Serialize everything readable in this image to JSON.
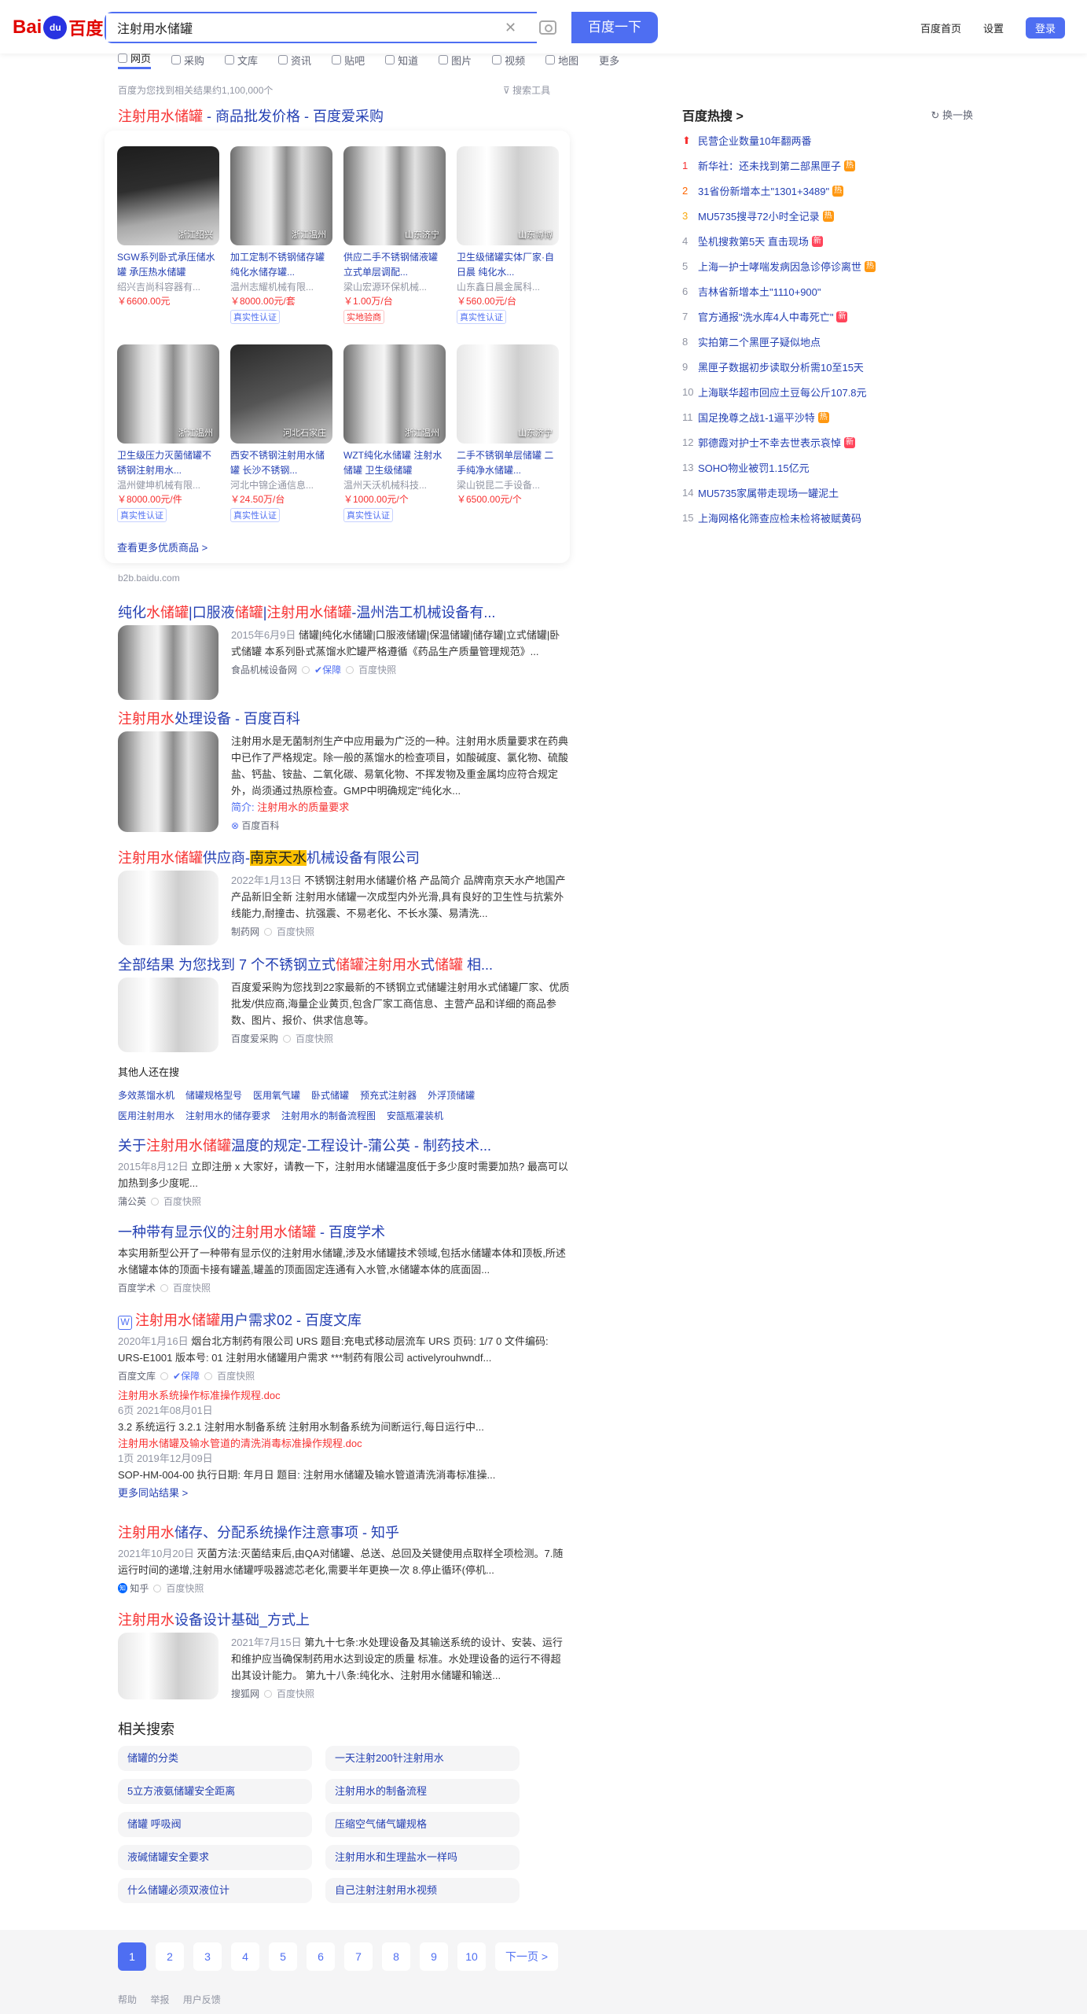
{
  "header": {
    "logo_bai": "Bai",
    "logo_paw": "du",
    "logo_du": "百度",
    "query": "注射用水储罐",
    "search_btn": "百度一下",
    "links": [
      "百度首页",
      "设置"
    ],
    "login": "登录"
  },
  "tabs": [
    "网页",
    "采购",
    "文库",
    "资讯",
    "贴吧",
    "知道",
    "图片",
    "视频",
    "地图",
    "更多"
  ],
  "result_info": "百度为您找到相关结果约1,100,000个",
  "tools": "搜索工具",
  "b2b": {
    "title_a": "注射用水储罐",
    "title_b": " - 商品批发价格 - 百度爱采购",
    "more": "查看更多优质商品 >",
    "domain": "b2b.baidu.com",
    "items": [
      {
        "loc": "浙江绍兴",
        "title": "SGW系列卧式承压储水罐 承压热水储罐",
        "company": "绍兴吉尚科容器有...",
        "price": "￥6600.00元",
        "badge": ""
      },
      {
        "loc": "浙江温州",
        "title": "加工定制不锈钢储存罐 纯化水储存罐...",
        "company": "温州志耀机械有限...",
        "price": "￥8000.00元/套",
        "badge": "真实性认证"
      },
      {
        "loc": "山东济宁",
        "title": "供应二手不锈钢储液罐 立式单层调配...",
        "company": "梁山宏源环保机械...",
        "price": "￥1.00万/台",
        "badge": "实地验商"
      },
      {
        "loc": "山东博博",
        "title": "卫生级储罐实体厂家·自日晨 纯化水...",
        "company": "山东鑫日晨金属科...",
        "price": "￥560.00元/台",
        "badge": "真实性认证"
      },
      {
        "loc": "浙江温州",
        "title": "卫生级压力灭菌储罐不锈钢注射用水...",
        "company": "温州健坤机械有限...",
        "price": "￥8000.00元/件",
        "badge": "真实性认证"
      },
      {
        "loc": "河北石家庄",
        "title": "西安不锈钢注射用水储罐 长沙不锈钢...",
        "company": "河北中锦企通信息...",
        "price": "￥24.50万/台",
        "badge": "真实性认证"
      },
      {
        "loc": "浙江温州",
        "title": "WZT纯化水储罐 注射水储罐 卫生级储罐",
        "company": "温州天沃机械科技...",
        "price": "￥1000.00元/个",
        "badge": "真实性认证"
      },
      {
        "loc": "山东济宁",
        "title": "二手不锈钢单层储罐 二手纯净水储罐...",
        "company": "梁山锐昆二手设备...",
        "price": "￥6500.00元/个",
        "badge": ""
      }
    ]
  },
  "results": [
    {
      "title": "纯化水储罐|口服液储罐|注射用水储罐-温州浩工机械设备有...",
      "date": "2015年6月9日",
      "text": "储罐|纯化水储罐|口服液储罐|保温储罐|储存罐|立式储罐|卧式储罐 本系列卧式蒸馏水贮罐严格遵循《药品生产质量管理规范》...",
      "source": "食品机械设备网",
      "snap": "百度快照"
    },
    {
      "title": "注射用水处理设备 - 百度百科",
      "text": "注射用水是无菌制剂生产中应用最为广泛的一种。注射用水质量要求在药典中已作了严格规定。除一般的蒸馏水的检查项目，如酸碱度、氯化物、硫酸盐、钙盐、铵盐、二氧化碳、易氧化物、不挥发物及重金属均应符合规定外，尚须通过热原检查。GMP中明确规定\"纯化水...",
      "sub_label": "简介:",
      "sub_link": "注射用水的质量要求",
      "source": "百度百科"
    },
    {
      "title": "注射用水储罐供应商-南京天水机械设备有限公司",
      "date": "2022年1月13日",
      "text": "不锈钢注射用水储罐价格 产品简介 品牌南京天水产地国产 产品新旧全新 注射用水储罐一次成型内外光滑,具有良好的卫生性与抗紫外线能力,耐撞击、抗强震、不易老化、不长水藻、易清洗...",
      "source": "制药网",
      "snap": "百度快照"
    },
    {
      "title": "全部结果 为您找到 7 个不锈钢立式储罐注射用水储罐 相...",
      "text": "百度爱采购为您找到22家最新的不锈钢立式储罐注射用水式储罐厂家、优质批发/供应商,海量企业黄页,包含厂家工商信息、主营产品和详细的商品参数、图片、报价、供求信息等。",
      "source": "百度爱采购",
      "snap": "百度快照"
    }
  ],
  "also": {
    "title": "其他人还在搜",
    "items": [
      "多效蒸馏水机",
      "储罐规格型号",
      "医用氧气罐",
      "卧式储罐",
      "预充式注射器",
      "外浮顶储罐",
      "医用注射用水",
      "注射用水的储存要求",
      "注射用水的制备流程图",
      "安瓿瓶灌装机"
    ]
  },
  "results2": [
    {
      "title": "关于注射用水储罐温度的规定-工程设计-蒲公英 - 制药技术...",
      "date": "2015年8月12日",
      "text": "立即注册 x 大家好，请教一下，注射用水储罐温度低于多少度时需要加热? 最高可以加热到多少度呢...",
      "source": "蒲公英",
      "snap": "百度快照"
    },
    {
      "title": "一种带有显示仪的注射用水储罐 - 百度学术",
      "text": "本实用新型公开了一种带有显示仪的注射用水储罐,涉及水储罐技术领域,包括水储罐本体和顶板,所述水储罐本体的顶面卡接有罐盖,罐盖的顶面固定连通有入水管,水储罐本体的底面固...",
      "source": "百度学术",
      "snap": "百度快照"
    },
    {
      "title": "注射用水储罐用户需求02 - 百度文库",
      "date": "2020年1月16日",
      "text": "烟台北方制药有限公司 URS 题目:充电式移动层流车 URS 页码: 1/7 0 文件编码: URS-E1001 版本号: 01 注射用水储罐用户需求 ***制药有限公司 activelyrouhwndf...",
      "source": "百度文库",
      "snap": "百度快照",
      "docs": [
        {
          "t": "注射用水系统操作标准操作规程.doc",
          "m": "6页  2021年08月01日",
          "d": "3.2 系统运行 3.2.1 注射用水制备系统 注射用水制备系统为间断运行,每日运行中..."
        },
        {
          "t": "注射用水储罐及输水管道的清洗消毒标准操作规程.doc",
          "m": "1页  2019年12月09日",
          "d": "SOP-HM-004-00 执行日期: 年月日 题目: 注射用水储罐及输水管道清洗消毒标准操..."
        }
      ],
      "more": "更多同站结果 >"
    },
    {
      "title": "注射用水储存、分配系统操作注意事项 - 知乎",
      "date": "2021年10月20日",
      "text": "灭菌方法:灭菌结束后,由QA对储罐、总送、总回及关键使用点取样全项检测。7.随运行时间的递增,注射用水储罐呼吸器滤芯老化,需要半年更换一次 8.停止循环(停机...",
      "source": "知乎",
      "snap": "百度快照"
    },
    {
      "title": "注射用水设备设计基础_方式上",
      "date": "2021年7月15日",
      "text": "第九十七条:水处理设备及其输送系统的设计、安装、运行和维护应当确保制药用水达到设定的质量 标准。水处理设备的运行不得超出其设计能力。 第九十八条:纯化水、注射用水储罐和输送...",
      "source": "搜狐网",
      "snap": "百度快照"
    }
  ],
  "hot": {
    "title": "百度热搜 >",
    "change": "换一换",
    "items": [
      {
        "rank": "⬆",
        "text": "民营企业数量10年翻两番",
        "badge": ""
      },
      {
        "rank": "1",
        "text": "新华社：还未找到第二部黑匣子",
        "badge": "热"
      },
      {
        "rank": "2",
        "text": "31省份新增本土\"1301+3489\"",
        "badge": "热"
      },
      {
        "rank": "3",
        "text": "MU5735搜寻72小时全记录",
        "badge": "热"
      },
      {
        "rank": "4",
        "text": "坠机搜救第5天 直击现场",
        "badge": "新"
      },
      {
        "rank": "5",
        "text": "上海一护士哮喘发病因急诊停诊离世",
        "badge": "热"
      },
      {
        "rank": "6",
        "text": "吉林省新增本土\"1110+900\"",
        "badge": ""
      },
      {
        "rank": "7",
        "text": "官方通报\"洗水库4人中毒死亡\"",
        "badge": "新"
      },
      {
        "rank": "8",
        "text": "实拍第二个黑匣子疑似地点",
        "badge": ""
      },
      {
        "rank": "9",
        "text": "黑匣子数据初步读取分析需10至15天",
        "badge": ""
      },
      {
        "rank": "10",
        "text": "上海联华超市回应土豆每公斤107.8元",
        "badge": ""
      },
      {
        "rank": "11",
        "text": "国足挽尊之战1-1逼平沙特",
        "badge": "热"
      },
      {
        "rank": "12",
        "text": "郭德霞对护士不幸去世表示哀悼",
        "badge": "新"
      },
      {
        "rank": "13",
        "text": "SOHO物业被罚1.15亿元",
        "badge": ""
      },
      {
        "rank": "14",
        "text": "MU5735家属带走现场一罐泥土",
        "badge": ""
      },
      {
        "rank": "15",
        "text": "上海网格化筛查应检未检将被赋黄码",
        "badge": ""
      }
    ]
  },
  "related": {
    "title": "相关搜索",
    "items": [
      "储罐的分类",
      "一天注射200针注射用水",
      "5立方液氨储罐安全距离",
      "注射用水的制备流程",
      "储罐 呼吸阀",
      "压缩空气储气罐规格",
      "液碱储罐安全要求",
      "注射用水和生理盐水一样吗",
      "什么储罐必须双液位计",
      "自己注射注射用水视频"
    ]
  },
  "pager": {
    "pages": [
      "1",
      "2",
      "3",
      "4",
      "5",
      "6",
      "7",
      "8",
      "9",
      "10"
    ],
    "next": "下一页 >"
  },
  "footer": [
    "帮助",
    "举报",
    "用户反馈"
  ]
}
